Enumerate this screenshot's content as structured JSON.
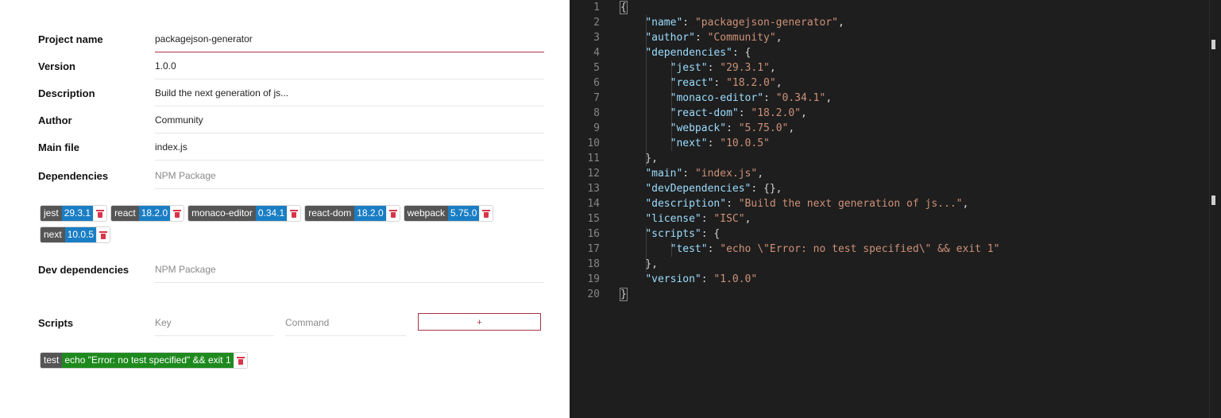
{
  "form": {
    "project_name": {
      "label": "Project name",
      "value": "packagejson-generator"
    },
    "version": {
      "label": "Version",
      "value": "1.0.0"
    },
    "description": {
      "label": "Description",
      "value": "Build the next generation of js..."
    },
    "author": {
      "label": "Author",
      "value": "Community"
    },
    "main_file": {
      "label": "Main file",
      "value": "index.js"
    },
    "dependencies": {
      "label": "Dependencies",
      "placeholder": "NPM Package",
      "tags": [
        {
          "name": "jest",
          "version": "29.3.1"
        },
        {
          "name": "react",
          "version": "18.2.0"
        },
        {
          "name": "monaco-editor",
          "version": "0.34.1"
        },
        {
          "name": "react-dom",
          "version": "18.2.0"
        },
        {
          "name": "webpack",
          "version": "5.75.0"
        },
        {
          "name": "next",
          "version": "10.0.5"
        }
      ]
    },
    "dev_dependencies": {
      "label": "Dev dependencies",
      "placeholder": "NPM Package"
    },
    "scripts": {
      "label": "Scripts",
      "key_placeholder": "Key",
      "command_placeholder": "Command",
      "add_label": "+",
      "tags": [
        {
          "name": "test",
          "command": "echo \"Error: no test specified\" && exit 1"
        }
      ]
    }
  },
  "editor": {
    "lines": [
      "{",
      "    \"name\": \"packagejson-generator\",",
      "    \"author\": \"Community\",",
      "    \"dependencies\": {",
      "        \"jest\": \"29.3.1\",",
      "        \"react\": \"18.2.0\",",
      "        \"monaco-editor\": \"0.34.1\",",
      "        \"react-dom\": \"18.2.0\",",
      "        \"webpack\": \"5.75.0\",",
      "        \"next\": \"10.0.5\"",
      "    },",
      "    \"main\": \"index.js\",",
      "    \"devDependencies\": {},",
      "    \"description\": \"Build the next generation of js...\",",
      "    \"license\": \"ISC\",",
      "    \"scripts\": {",
      "        \"test\": \"echo \\\"Error: no test specified\\\" && exit 1\"",
      "    },",
      "    \"version\": \"1.0.0\"",
      "}"
    ]
  },
  "colors": {
    "accent": "#a83244",
    "tag_key_bg": "#555555",
    "tag_value_bg": "#1a7ec4",
    "script_value_bg": "#1e8a1e",
    "editor_bg": "#1e1e1e",
    "json_key": "#9cdcfe",
    "json_string": "#ce9178"
  }
}
